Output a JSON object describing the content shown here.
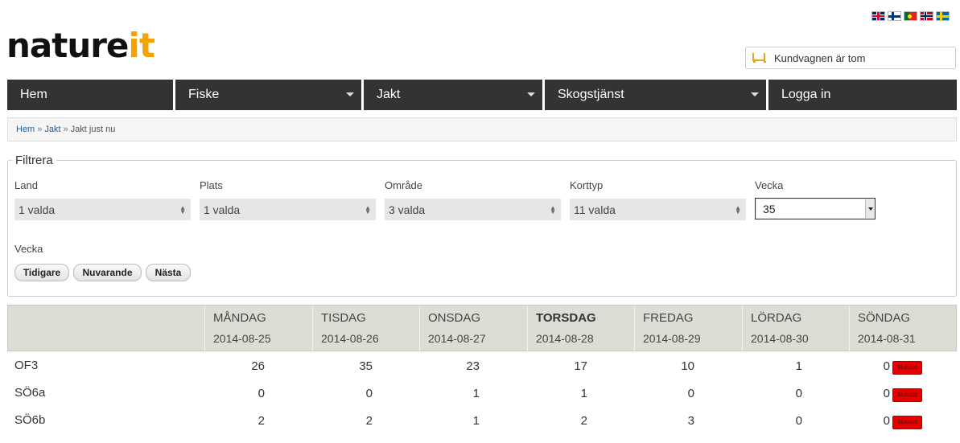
{
  "colors": {
    "nav_bg": "#333333",
    "logo_accent": "#f5a300",
    "sold_badge": "#e60000",
    "table_head": "#ddddd5"
  },
  "flags": [
    "gb-flag-icon",
    "fi-flag-icon",
    "pt-flag-icon",
    "no-flag-icon",
    "se-flag-icon"
  ],
  "logo": {
    "part1": "nature",
    "part2": "it"
  },
  "cart": {
    "label": "Kundvagnen är tom"
  },
  "nav": [
    {
      "label": "Hem",
      "dropdown": false
    },
    {
      "label": "Fiske",
      "dropdown": true
    },
    {
      "label": "Jakt",
      "dropdown": true
    },
    {
      "label": "Skogstjänst",
      "dropdown": true
    },
    {
      "label": "Logga in",
      "dropdown": false
    }
  ],
  "breadcrumb": {
    "home": "Hem",
    "section": "Jakt",
    "current": "Jakt just nu",
    "separator": "»"
  },
  "filter": {
    "legend": "Filtrera",
    "fields": [
      {
        "label": "Land",
        "value": "1 valda"
      },
      {
        "label": "Plats",
        "value": "1 valda"
      },
      {
        "label": "Område",
        "value": "3 valda"
      },
      {
        "label": "Korttyp",
        "value": "11 valda"
      }
    ],
    "week_label": "Vecka",
    "week_value": "35",
    "week_nav_label": "Vecka",
    "buttons": [
      "Tidigare",
      "Nuvarande",
      "Nästa"
    ]
  },
  "table": {
    "days": [
      {
        "day": "MÅNDAG",
        "date": "2014-08-25"
      },
      {
        "day": "TISDAG",
        "date": "2014-08-26"
      },
      {
        "day": "ONSDAG",
        "date": "2014-08-27"
      },
      {
        "day": "TORSDAG",
        "date": "2014-08-28",
        "today": true
      },
      {
        "day": "FREDAG",
        "date": "2014-08-29"
      },
      {
        "day": "LÖRDAG",
        "date": "2014-08-30"
      },
      {
        "day": "SÖNDAG",
        "date": "2014-08-31"
      }
    ],
    "rows": [
      {
        "name": "OF3",
        "values": [
          "26",
          "35",
          "23",
          "17",
          "10",
          "1",
          "0"
        ],
        "badge": "Slutsåld"
      },
      {
        "name": "SÖ6a",
        "values": [
          "0",
          "0",
          "1",
          "1",
          "0",
          "0",
          "0"
        ],
        "badge": "Slutsåld"
      },
      {
        "name": "SÖ6b",
        "values": [
          "2",
          "2",
          "1",
          "2",
          "3",
          "0",
          "0"
        ],
        "badge": "Slutsåld"
      }
    ]
  }
}
